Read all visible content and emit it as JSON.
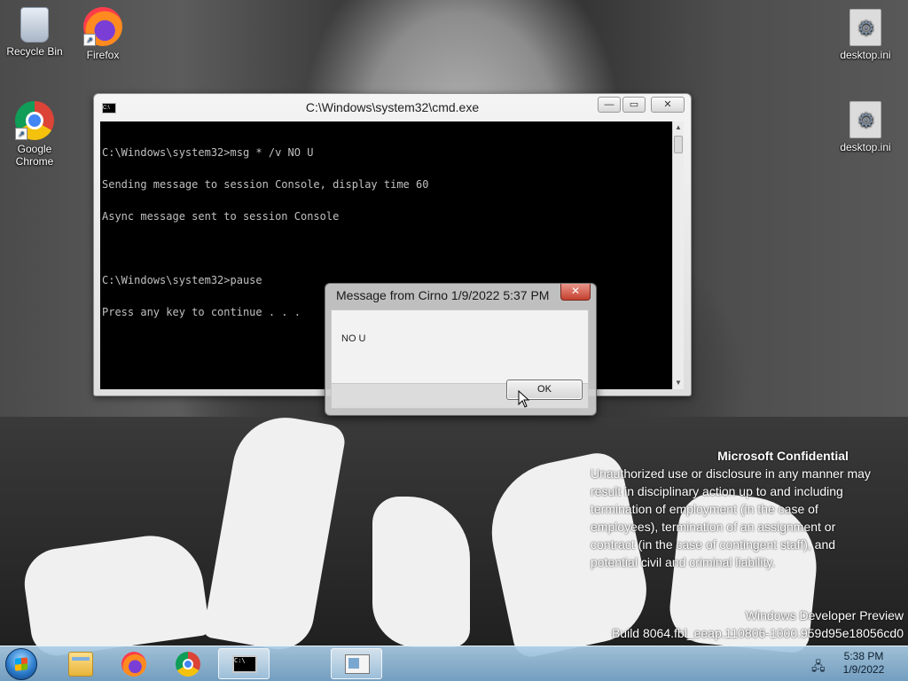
{
  "desktop": {
    "icons": [
      {
        "label": "Recycle Bin",
        "icon": "recycle-bin-icon"
      },
      {
        "label": "Firefox",
        "icon": "firefox-icon"
      },
      {
        "label": "Google Chrome",
        "icon": "chrome-icon"
      },
      {
        "label": "desktop.ini",
        "icon": "settings-file-icon"
      },
      {
        "label": "desktop.ini",
        "icon": "settings-file-icon"
      }
    ]
  },
  "cmd_window": {
    "title": "C:\\Windows\\system32\\cmd.exe",
    "sys_icon_text": "C:\\",
    "minimize": "—",
    "maximize": "▭",
    "close": "✕",
    "lines": [
      "C:\\Windows\\system32>msg * /v NO U",
      "Sending message to session Console, display time 60",
      "Async message sent to session Console",
      "",
      "C:\\Windows\\system32>pause",
      "Press any key to continue . . ."
    ]
  },
  "message_box": {
    "title": "Message from Cirno 1/9/2022 5:37 PM",
    "close": "✕",
    "message": "NO U",
    "ok_label": "OK"
  },
  "watermark": {
    "heading": "Microsoft Confidential",
    "lines": [
      "Unauthorized use or disclosure in any manner may",
      "result in disciplinary action up to and including",
      "termination of employment (in the case of",
      "employees), termination of an assignment or",
      "contract (in the case of contingent staff), and",
      "potential civil and criminal liability."
    ],
    "product": "Windows Developer Preview",
    "build": "Build 8064.fbl_eeap.110806-1000.959d95e18056cd0"
  },
  "taskbar": {
    "buttons": [
      {
        "name": "file-explorer",
        "icon": "folder-icon",
        "active": false
      },
      {
        "name": "firefox",
        "icon": "firefox-icon",
        "active": false
      },
      {
        "name": "chrome",
        "icon": "chrome-icon",
        "active": false
      },
      {
        "name": "cmd",
        "icon": "cmd-icon",
        "active": true
      },
      {
        "name": "message",
        "icon": "message-window-icon",
        "active": true
      }
    ],
    "tray_network": "🖧",
    "time": "5:38 PM",
    "date": "1/9/2022"
  }
}
